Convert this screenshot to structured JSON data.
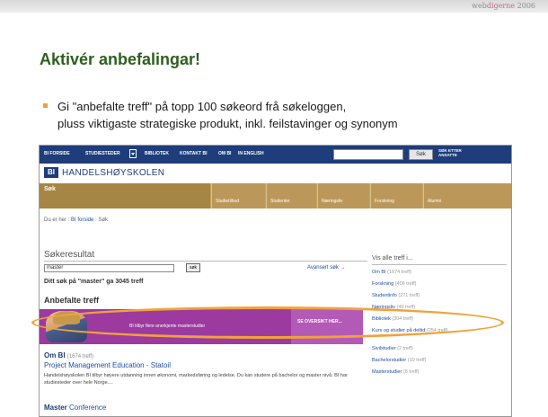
{
  "header": {
    "brand_prefix": "web",
    "brand_highlight": "digerne",
    "brand_year": "2006"
  },
  "slide": {
    "title": "Aktivér anbefalingar!",
    "bullet_line1": "Gi \"anbefalte treff\" på topp 100 søkeord frå søkeloggen,",
    "bullet_line2": "pluss viktigaste strategiske produkt, inkl. feilstavinger og synonym"
  },
  "site": {
    "nav": [
      "BI FORSIDE",
      "STUDIESTEDER",
      "BIBLIOTEK",
      "KONTAKT BI",
      "OM BI",
      "IN ENGLISH"
    ],
    "nav_search_button": "Søk",
    "nav_employee_search": "SØK ETTER ANSATTE",
    "logo_mark": "BI",
    "logo_text": "HANDELSHØYSKOLEN",
    "active_tab": "Søk",
    "tabs": [
      "Studietilbud",
      "Studenter",
      "Næringsliv",
      "Forskning",
      "Alumni"
    ],
    "breadcrumb_prefix": "Du er her : ",
    "breadcrumb_home": "BI forside",
    "breadcrumb_current": " : Søk",
    "results_heading": "Søkeresultat",
    "query": "master",
    "search_button": "søk",
    "advanced_search": "Avansert søk",
    "count_text": "Ditt søk på \"master\" ga 3045 treff",
    "recommended_heading": "Anbefalte treff",
    "banner_text": "BI tilbyr flere anerkjente masterstudier",
    "banner_cta": "SE OVERSIKT HER...",
    "result_category": "Om BI",
    "result_category_count": "(1674 treff)",
    "result_title": "Project Management Education - Statoil",
    "result_snippet": "Handelshøyskolen BI tilbyr høyere utdanning innen økonomi, markedsføring og ledelse. Du kan studere på bachelor og master nivå. BI har studiesteder over hele Norge....",
    "result2_bold": "Master",
    "result2_rest": " Conference",
    "sidebar_heading": "Vis alle treff i...",
    "sidebar": [
      {
        "label": "Om BI",
        "count": "(1674 treff)"
      },
      {
        "label": "Forskning",
        "count": "(406 treff)"
      },
      {
        "label": "Studentinfo",
        "count": "(271 treff)"
      },
      {
        "label": "Næringsliv",
        "count": "(49 treff)"
      },
      {
        "label": "Bibliotek",
        "count": "(304 treff)"
      },
      {
        "label": "Kurs og studier på deltid",
        "count": "(254 treff)"
      },
      {
        "label": "Sivilstudier",
        "count": "(2 treff)"
      },
      {
        "label": "Bachelorstudier",
        "count": "(10 treff)"
      },
      {
        "label": "Masterstudier",
        "count": "(8 treff)"
      }
    ]
  },
  "colors": {
    "accent_orange": "#f1a23a",
    "nav_blue": "#1f3d7a",
    "title_green": "#2e5f1e",
    "banner_purple": "#9c3aa0"
  }
}
